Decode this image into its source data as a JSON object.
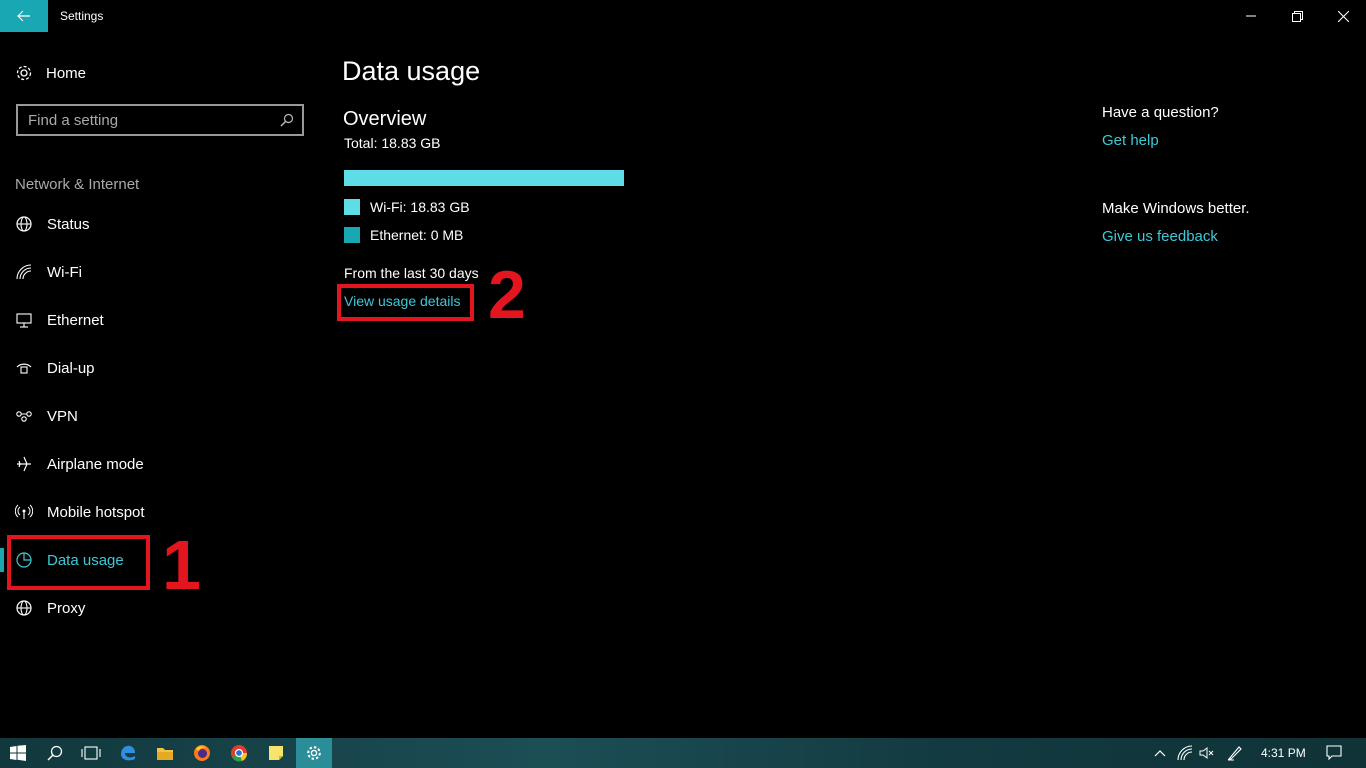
{
  "window": {
    "title": "Settings",
    "back_icon": "back-arrow-icon",
    "controls": [
      "minimize-icon",
      "restore-icon",
      "close-icon"
    ]
  },
  "sidebar": {
    "home_label": "Home",
    "search_placeholder": "Find a setting",
    "section_label": "Network & Internet",
    "items": [
      {
        "label": "Status",
        "icon": "globe-status-icon"
      },
      {
        "label": "Wi-Fi",
        "icon": "wifi-icon"
      },
      {
        "label": "Ethernet",
        "icon": "ethernet-icon"
      },
      {
        "label": "Dial-up",
        "icon": "dialup-icon"
      },
      {
        "label": "VPN",
        "icon": "vpn-icon"
      },
      {
        "label": "Airplane mode",
        "icon": "airplane-icon"
      },
      {
        "label": "Mobile hotspot",
        "icon": "hotspot-icon"
      },
      {
        "label": "Data usage",
        "icon": "pie-chart-icon",
        "active": true
      },
      {
        "label": "Proxy",
        "icon": "globe-icon"
      }
    ]
  },
  "main": {
    "title": "Data usage",
    "overview_title": "Overview",
    "total": "Total: 18.83 GB",
    "usage_share_wifi": 1.0,
    "legend": [
      {
        "label": "Wi-Fi: 18.83 GB",
        "color": "#5fdde6"
      },
      {
        "label": "Ethernet: 0 MB",
        "color": "#1aa7b4"
      }
    ],
    "period": "From the last 30 days",
    "view_link": "View usage details"
  },
  "related": {
    "question": "Have a question?",
    "help_link": "Get help",
    "better": "Make Windows better.",
    "feedback_link": "Give us feedback"
  },
  "annotations": {
    "step1": "1",
    "step2": "2",
    "color": "#e3161f"
  },
  "taskbar": {
    "clock": "4:31 PM",
    "accent": "#1aa7b4"
  }
}
